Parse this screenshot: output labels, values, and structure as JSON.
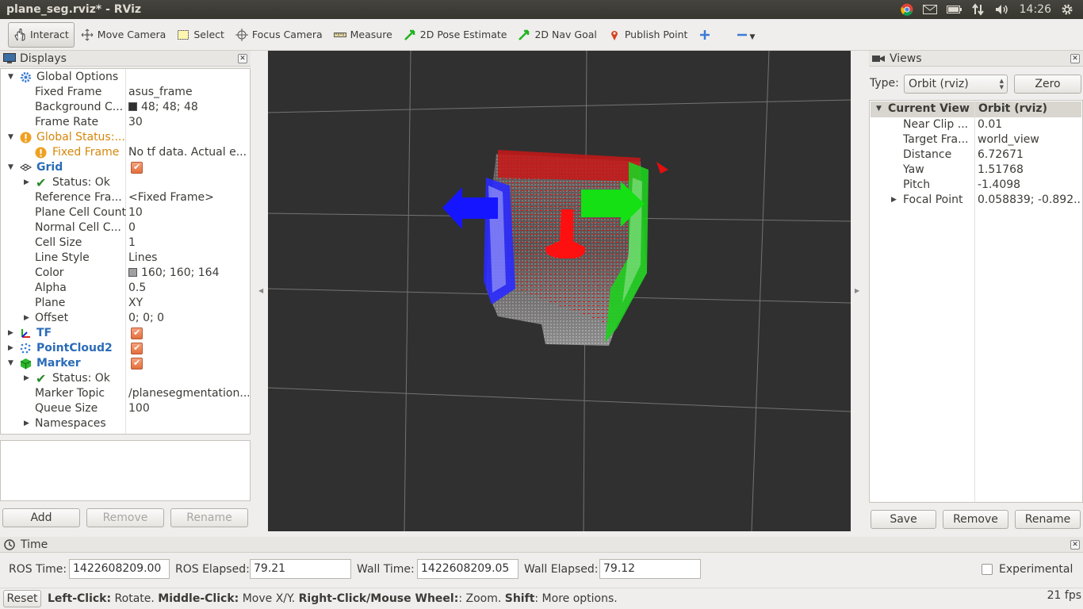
{
  "window": {
    "title": "plane_seg.rviz* - RViz"
  },
  "tray": {
    "clock": "14:26"
  },
  "toolbar": {
    "interact": "Interact",
    "move_camera": "Move Camera",
    "select": "Select",
    "focus_camera": "Focus Camera",
    "measure": "Measure",
    "pose_estimate": "2D Pose Estimate",
    "nav_goal": "2D Nav Goal",
    "publish_point": "Publish Point"
  },
  "displays": {
    "title": "Displays",
    "rows": [
      {
        "label": "Global Options"
      },
      {
        "label": "Fixed Frame",
        "value": "asus_frame"
      },
      {
        "label": "Background C...",
        "value": "48; 48; 48"
      },
      {
        "label": "Frame Rate",
        "value": "30"
      },
      {
        "label": "Global Status:..."
      },
      {
        "label": "Fixed Frame",
        "value": "No tf data.  Actual e..."
      },
      {
        "label": "Grid"
      },
      {
        "label": "Status: Ok"
      },
      {
        "label": "Reference Fra...",
        "value": "<Fixed Frame>"
      },
      {
        "label": "Plane Cell Count",
        "value": "10"
      },
      {
        "label": "Normal Cell C...",
        "value": "0"
      },
      {
        "label": "Cell Size",
        "value": "1"
      },
      {
        "label": "Line Style",
        "value": "Lines"
      },
      {
        "label": "Color",
        "value": "160; 160; 164"
      },
      {
        "label": "Alpha",
        "value": "0.5"
      },
      {
        "label": "Plane",
        "value": "XY"
      },
      {
        "label": "Offset",
        "value": "0; 0; 0"
      },
      {
        "label": "TF"
      },
      {
        "label": "PointCloud2"
      },
      {
        "label": "Marker"
      },
      {
        "label": "Status: Ok"
      },
      {
        "label": "Marker Topic",
        "value": "/planesegmentation..."
      },
      {
        "label": "Queue Size",
        "value": "100"
      },
      {
        "label": "Namespaces"
      }
    ],
    "buttons": {
      "add": "Add",
      "remove": "Remove",
      "rename": "Rename"
    }
  },
  "views": {
    "title": "Views",
    "type_label": "Type:",
    "type_value": "Orbit (rviz)",
    "zero": "Zero",
    "header": {
      "name": "Current View",
      "value": "Orbit (rviz)"
    },
    "rows": [
      {
        "label": "Near Clip ...",
        "value": "0.01"
      },
      {
        "label": "Target Fra...",
        "value": "world_view"
      },
      {
        "label": "Distance",
        "value": "6.72671"
      },
      {
        "label": "Yaw",
        "value": "1.51768"
      },
      {
        "label": "Pitch",
        "value": "-1.4098"
      },
      {
        "label": "Focal Point",
        "value": "0.058839; -0.892..."
      }
    ],
    "buttons": {
      "save": "Save",
      "remove": "Remove",
      "rename": "Rename"
    }
  },
  "time": {
    "title": "Time",
    "ros_time_label": "ROS Time:",
    "ros_time": "1422608209.00",
    "ros_elapsed_label": "ROS Elapsed:",
    "ros_elapsed": "79.21",
    "wall_time_label": "Wall Time:",
    "wall_time": "1422608209.05",
    "wall_elapsed_label": "Wall Elapsed:",
    "wall_elapsed": "79.12",
    "experimental": "Experimental"
  },
  "status": {
    "reset": "Reset",
    "b1": "Left-Click:",
    "t1": " Rotate. ",
    "b2": "Middle-Click:",
    "t2": " Move X/Y. ",
    "b3": "Right-Click/Mouse Wheel:",
    "t3": ": Zoom. ",
    "b4": "Shift",
    "t4": ": More options.",
    "fps": "21 fps"
  },
  "colors": {
    "background": "#303030",
    "accent": "#2b6cb7",
    "warning": "#d5870a"
  }
}
